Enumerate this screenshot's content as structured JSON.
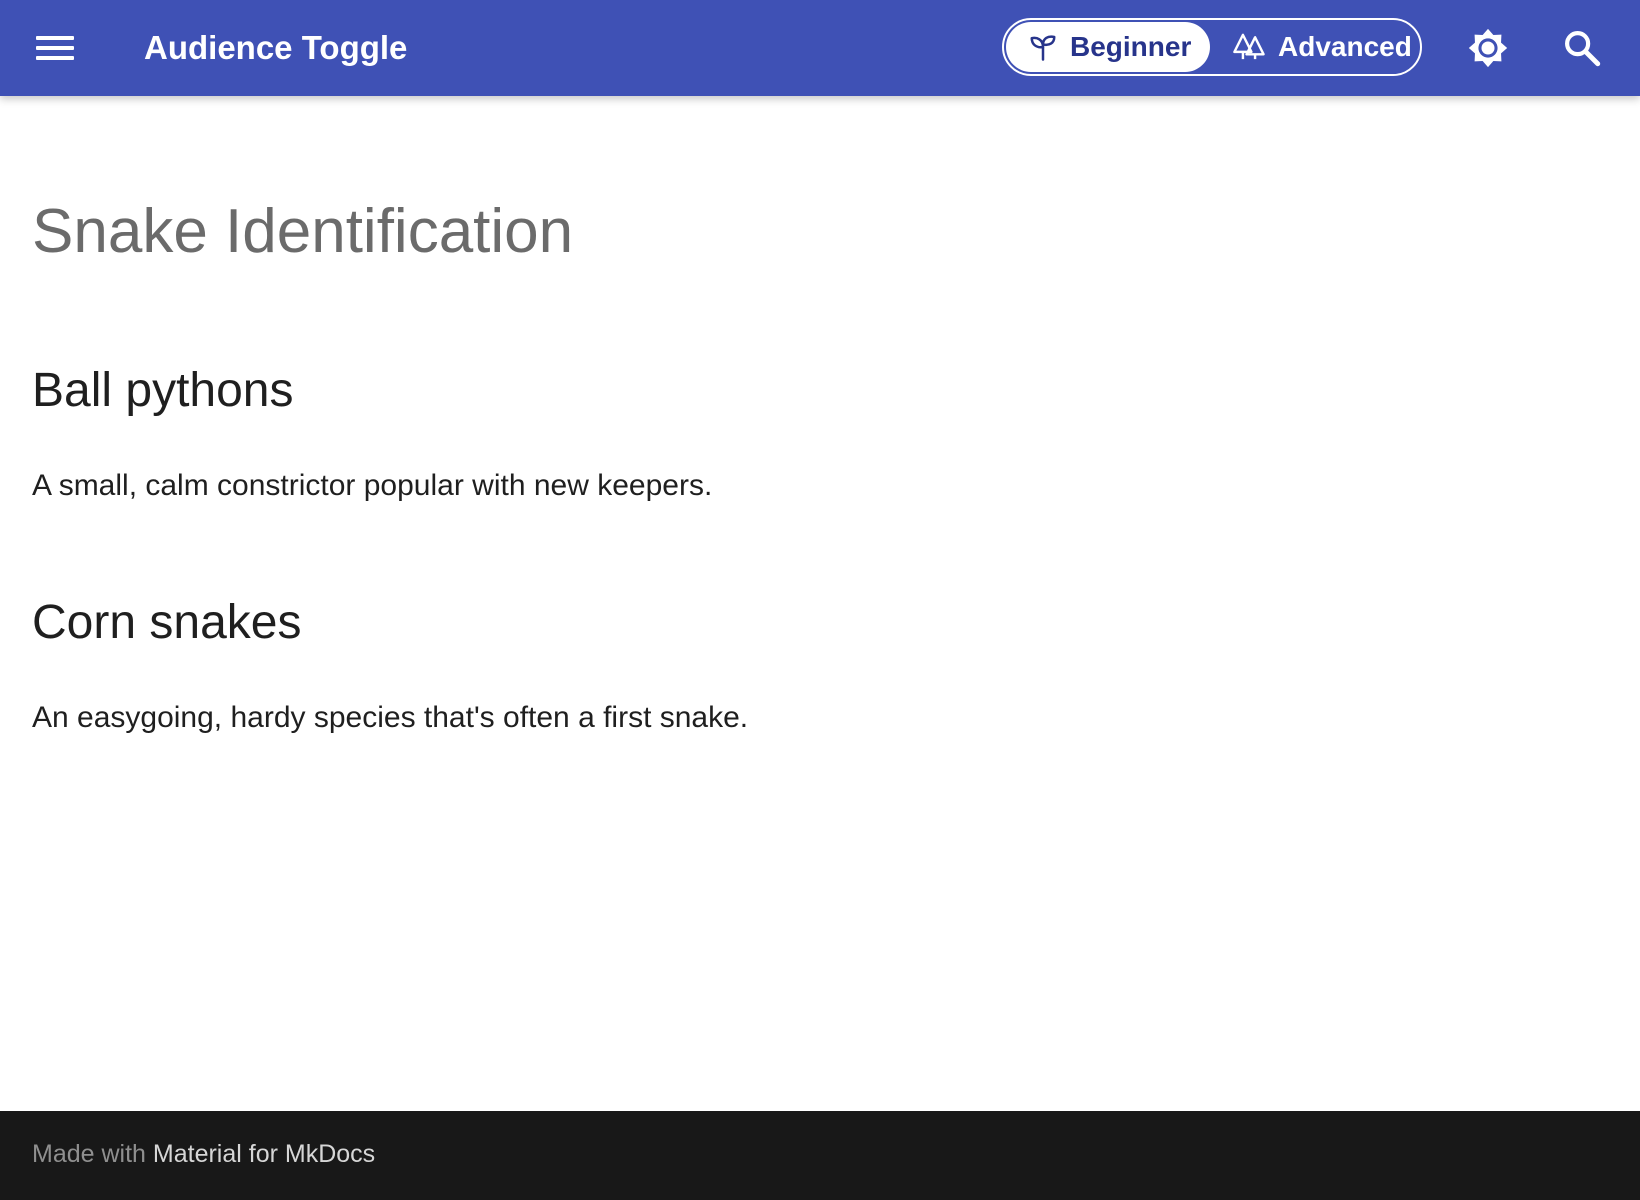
{
  "header": {
    "title": "Audience Toggle",
    "background_color": "#3f51b5",
    "menu_icon": "hamburger-menu-icon",
    "audience_toggle": {
      "options": [
        {
          "label": "Beginner",
          "icon": "sprout-icon",
          "selected": true
        },
        {
          "label": "Advanced",
          "icon": "forest-icon",
          "selected": false
        }
      ],
      "selected_text_color": "#27348b"
    },
    "theme_icon": "brightness-icon",
    "search_icon": "search-icon"
  },
  "main": {
    "title": "Snake Identification",
    "sections": [
      {
        "heading": "Ball pythons",
        "text": "A small, calm constrictor popular with new keepers."
      },
      {
        "heading": "Corn snakes",
        "text": "An easygoing, hardy species that's often a first snake."
      }
    ]
  },
  "footer": {
    "prefix": "Made with ",
    "link": "Material for MkDocs",
    "background_color": "#181818"
  }
}
